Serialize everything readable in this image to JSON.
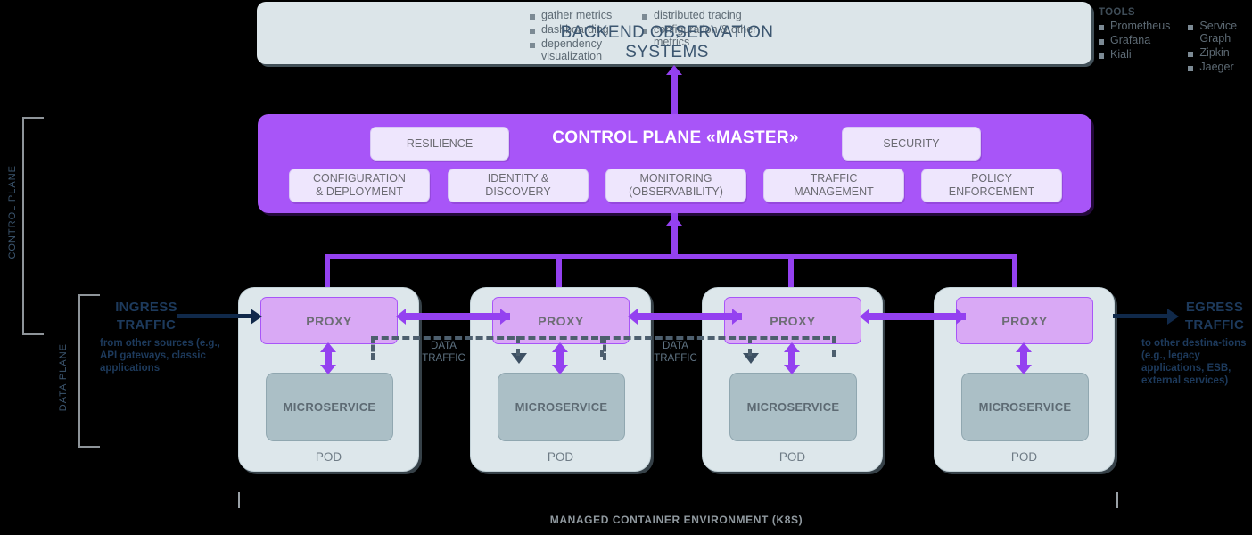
{
  "backend": {
    "title": "BACKEND OBSERVATION SYSTEMS",
    "features_col1": [
      "gather metrics",
      "dashboarding",
      "dependency visualization"
    ],
    "features_col2": [
      "distributed tracing",
      "configuration & other metrics"
    ],
    "tools_label": "TOOLS",
    "tools_col1": [
      "Prometheus",
      "Grafana",
      "Kiali"
    ],
    "tools_col2": [
      "Service Graph",
      "Zipkin",
      "Jaeger"
    ]
  },
  "control_plane": {
    "title": "CONTROL PLANE «MASTER»",
    "resilience": "RESILIENCE",
    "security": "SECURITY",
    "capabilities": [
      "CONFIGURATION\n& DEPLOYMENT",
      "IDENTITY &\nDISCOVERY",
      "MONITORING\n(OBSERVABILITY)",
      "TRAFFIC\nMANAGEMENT",
      "POLICY\nENFORCEMENT"
    ]
  },
  "pods": [
    {
      "proxy": "PROXY",
      "service": "MICROSERVICE",
      "label": "POD"
    },
    {
      "proxy": "PROXY",
      "service": "MICROSERVICE",
      "label": "POD"
    },
    {
      "proxy": "PROXY",
      "service": "MICROSERVICE",
      "label": "POD"
    },
    {
      "proxy": "PROXY",
      "service": "MICROSERVICE",
      "label": "POD"
    }
  ],
  "data_traffic": {
    "line1": "DATA",
    "line2": "TRAFFIC"
  },
  "ingress": {
    "title_line1": "INGRESS",
    "title_line2": "TRAFFIC",
    "subtitle": "from other sources (e.g., API gateways, classic applications"
  },
  "egress": {
    "title_line1": "EGRESS",
    "title_line2": "TRAFFIC",
    "subtitle": "to other destina‑tions (e.g., legacy applications, ESB, external services)"
  },
  "planes": {
    "control": "CONTROL PLANE",
    "data": "DATA PLANE"
  },
  "footer": {
    "label": "MANAGED CONTAINER ENVIRONMENT (K8S)"
  },
  "colors": {
    "background": "#000000",
    "panel": "#dce5e9",
    "control_plane": "#a855f8",
    "proxy": "#d9a9f5",
    "microservice": "#abbfc6",
    "pod": "#dde7eb",
    "navy": "#10294a",
    "dashed": "#4d5f6e"
  }
}
